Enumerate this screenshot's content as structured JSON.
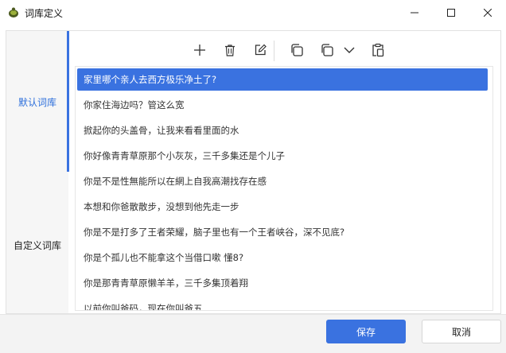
{
  "window": {
    "title": "词库定义"
  },
  "sidebar": {
    "items": [
      {
        "label": "默认词库",
        "active": true
      },
      {
        "label": "自定义词库",
        "active": false
      }
    ]
  },
  "toolbar": {
    "icons": [
      "plus-icon",
      "trash-icon",
      "edit-icon",
      "copy-icon",
      "copy-dropdown-icon",
      "chevron-down-icon",
      "paste-icon"
    ]
  },
  "list": {
    "items": [
      "家里哪个亲人去西方极乐净土了?",
      "你家住海边吗？管这么宽",
      "掀起你的头盖骨，让我来看看里面的水",
      "你好像青青草原那个小灰灰，三千多集还是个儿子",
      "你是不是性無能所以在網上自我高潮找存在感",
      "本想和你爸散散步，没想到他先走一步",
      "你是不是打多了王者荣耀，脑子里也有一个王者峡谷，深不见底?",
      "你是个孤儿也不能拿这个当借口嗽 懂8?",
      "你是那青青草原懒羊羊，三千多集顶着翔",
      "以前你叫爸码，现在你叫爸五"
    ],
    "selected_index": 0
  },
  "footer": {
    "save_label": "保存",
    "cancel_label": "取消"
  },
  "colors": {
    "accent": "#3a72e0"
  }
}
